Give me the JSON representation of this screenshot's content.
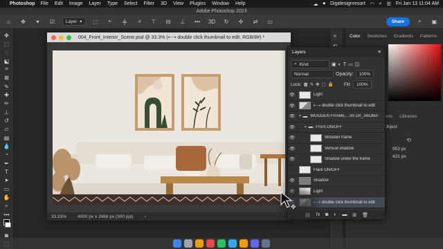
{
  "menubar": {
    "app_name": "Photoshop",
    "items": [
      "File",
      "Edit",
      "Image",
      "Layer",
      "Type",
      "Select",
      "Filter",
      "3D",
      "View",
      "Plugins",
      "Window",
      "Help"
    ],
    "user": "Digidesignresort",
    "datetime": "Fri Jan 13  11:04 AM"
  },
  "app_title": "Adobe Photoshop 2023",
  "options_bar": {
    "auto_select_target": "Layer",
    "share_label": "Share"
  },
  "document": {
    "title": "004_Front_Interior_Scene.psd @ 33.3% (⇠⇢ double click thumbnail to edit, RGB/8#) *",
    "zoom": "33.33%",
    "doc_info": "4000 px x 2668 px (300 ppi)"
  },
  "color_panel": {
    "tabs": [
      "Color",
      "Swatches",
      "Gradients",
      "Patterns"
    ],
    "active_tab": "Color",
    "lib_tabs": [
      "ents",
      "Libraries"
    ],
    "props_label": "Object",
    "w_value": "953 px",
    "y_value": "421 px",
    "accent": "#1473e6"
  },
  "layers_panel": {
    "title": "Layers",
    "filter_kind": "Kind",
    "blend_mode": "Normal",
    "opacity_label": "Opacity:",
    "opacity_value": "100%",
    "lock_label": "Lock:",
    "fill_label": "Fill:",
    "fill_value": "100%",
    "layers": [
      {
        "name": "Light",
        "visible": true,
        "thumb": "light",
        "indent": 0,
        "selected": false,
        "folder": false
      },
      {
        "name": "⇠⇢ double click thumbnail to edit",
        "visible": true,
        "thumb": "mix",
        "indent": 0,
        "selected": false,
        "folder": false
      },
      {
        "name": "WOODEN FRAME....90 cm_24x36in",
        "visible": true,
        "thumb": "none",
        "indent": 0,
        "selected": false,
        "folder": true
      },
      {
        "name": "Front ON/OFF",
        "visible": true,
        "thumb": "none",
        "indent": 1,
        "selected": false,
        "folder": true
      },
      {
        "name": "Wooden frame",
        "visible": true,
        "thumb": "light",
        "indent": 2,
        "selected": false,
        "folder": false
      },
      {
        "name": "Vertical shadow",
        "visible": true,
        "thumb": "light",
        "indent": 2,
        "selected": false,
        "folder": false
      },
      {
        "name": "Shadow under the frame",
        "visible": true,
        "thumb": "light",
        "indent": 2,
        "selected": false,
        "folder": false
      },
      {
        "name": "Flare ON/OFF",
        "visible": false,
        "thumb": "light",
        "indent": 0,
        "selected": false,
        "folder": false
      },
      {
        "name": "Shadow",
        "visible": true,
        "thumb": "dark",
        "indent": 0,
        "selected": false,
        "folder": false
      },
      {
        "name": "Light",
        "visible": true,
        "thumb": "light",
        "indent": 0,
        "selected": false,
        "folder": false
      },
      {
        "name": "⇠⇢ double click thumbnail to edit",
        "visible": true,
        "thumb": "mix",
        "indent": 0,
        "selected": true,
        "folder": false
      }
    ]
  }
}
